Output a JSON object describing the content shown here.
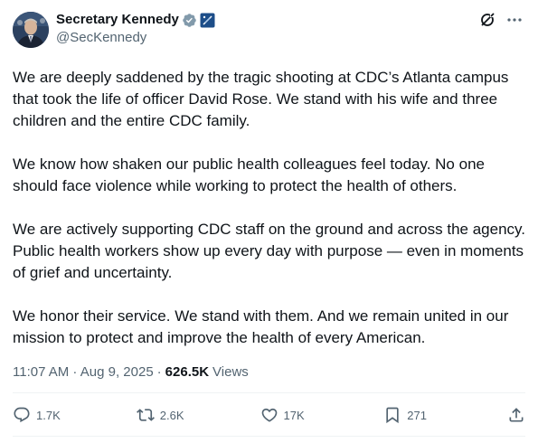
{
  "author": {
    "display_name": "Secretary Kennedy",
    "handle": "@SecKennedy",
    "verified_badge_icon": "verified-badge-icon",
    "affiliation_icon": "government-affiliation-icon"
  },
  "header_actions": {
    "grok_icon": "grok-icon",
    "more_icon": "more-icon"
  },
  "body": {
    "paragraphs": [
      "We are deeply saddened by the tragic shooting at CDC’s Atlanta campus that took the life of officer David Rose. We stand with his wife and three children and the entire CDC family.",
      "We know how shaken our public health colleagues feel today. No one should face violence while working to protect the health of others.",
      "We are actively supporting CDC staff on the ground and across the agency. Public health workers show up every day with purpose — even in moments of grief and uncertainty.",
      "We honor their service. We stand with them. And we remain united in our mission to protect and improve the health of every American."
    ]
  },
  "meta": {
    "timestamp": "11:07 AM · Aug 9, 2025",
    "separator": "·",
    "views_count": "626.5K",
    "views_label": "Views"
  },
  "actions": {
    "replies": "1.7K",
    "reposts": "2.6K",
    "likes": "17K",
    "bookmarks": "271"
  },
  "colors": {
    "text_primary": "#0f1419",
    "text_secondary": "#536471",
    "verified_badge": "#829aab",
    "affiliation_badge": "#1d4e89",
    "divider": "#eff3f4"
  }
}
